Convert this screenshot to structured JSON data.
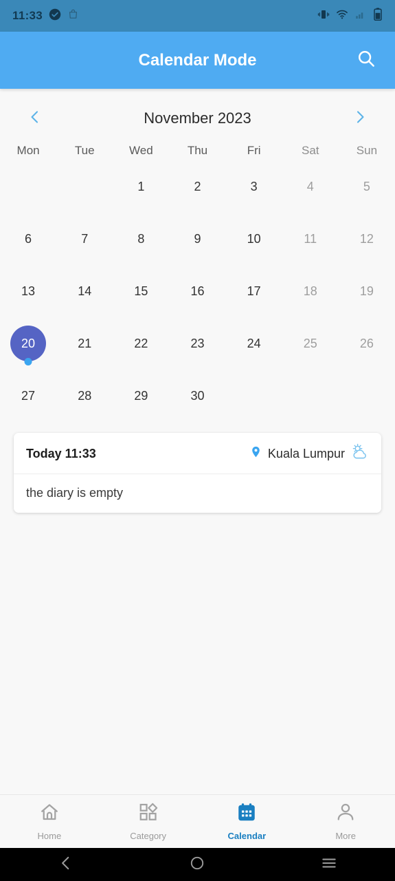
{
  "status_bar": {
    "time": "11:33",
    "left_icons": [
      "check-circle-icon",
      "bag-icon"
    ],
    "right_icons": [
      "vibrate-icon",
      "wifi-icon",
      "signal-icon",
      "battery-icon"
    ]
  },
  "app_bar": {
    "title": "Calendar Mode",
    "search_icon": "search-icon",
    "background": "#4fabf2"
  },
  "calendar": {
    "month_title": "November 2023",
    "prev_icon": "chevron-left-icon",
    "next_icon": "chevron-right-icon",
    "weekdays": [
      {
        "label": "Mon",
        "weekend": false
      },
      {
        "label": "Tue",
        "weekend": false
      },
      {
        "label": "Wed",
        "weekend": false
      },
      {
        "label": "Thu",
        "weekend": false
      },
      {
        "label": "Fri",
        "weekend": false
      },
      {
        "label": "Sat",
        "weekend": true
      },
      {
        "label": "Sun",
        "weekend": true
      }
    ],
    "selected_day": 20,
    "selected_color": "#5564c4",
    "event_dot_color": "#3aa5f0",
    "weeks": [
      [
        {
          "day": "",
          "weekend": false,
          "empty": true
        },
        {
          "day": "",
          "weekend": false,
          "empty": true
        },
        {
          "day": "1",
          "weekend": false,
          "empty": false
        },
        {
          "day": "2",
          "weekend": false,
          "empty": false
        },
        {
          "day": "3",
          "weekend": false,
          "empty": false
        },
        {
          "day": "4",
          "weekend": true,
          "empty": false
        },
        {
          "day": "5",
          "weekend": true,
          "empty": false
        }
      ],
      [
        {
          "day": "6",
          "weekend": false,
          "empty": false
        },
        {
          "day": "7",
          "weekend": false,
          "empty": false
        },
        {
          "day": "8",
          "weekend": false,
          "empty": false
        },
        {
          "day": "9",
          "weekend": false,
          "empty": false
        },
        {
          "day": "10",
          "weekend": false,
          "empty": false
        },
        {
          "day": "11",
          "weekend": true,
          "empty": false
        },
        {
          "day": "12",
          "weekend": true,
          "empty": false
        }
      ],
      [
        {
          "day": "13",
          "weekend": false,
          "empty": false
        },
        {
          "day": "14",
          "weekend": false,
          "empty": false
        },
        {
          "day": "15",
          "weekend": false,
          "empty": false
        },
        {
          "day": "16",
          "weekend": false,
          "empty": false
        },
        {
          "day": "17",
          "weekend": false,
          "empty": false
        },
        {
          "day": "18",
          "weekend": true,
          "empty": false
        },
        {
          "day": "19",
          "weekend": true,
          "empty": false
        }
      ],
      [
        {
          "day": "20",
          "weekend": false,
          "empty": false,
          "selected": true,
          "has_event": true
        },
        {
          "day": "21",
          "weekend": false,
          "empty": false
        },
        {
          "day": "22",
          "weekend": false,
          "empty": false
        },
        {
          "day": "23",
          "weekend": false,
          "empty": false
        },
        {
          "day": "24",
          "weekend": false,
          "empty": false
        },
        {
          "day": "25",
          "weekend": true,
          "empty": false
        },
        {
          "day": "26",
          "weekend": true,
          "empty": false
        }
      ],
      [
        {
          "day": "27",
          "weekend": false,
          "empty": false
        },
        {
          "day": "28",
          "weekend": false,
          "empty": false
        },
        {
          "day": "29",
          "weekend": false,
          "empty": false
        },
        {
          "day": "30",
          "weekend": false,
          "empty": false
        },
        {
          "day": "",
          "weekend": false,
          "empty": true
        },
        {
          "day": "",
          "weekend": true,
          "empty": true
        },
        {
          "day": "",
          "weekend": true,
          "empty": true
        }
      ]
    ]
  },
  "diary_card": {
    "today_label": "Today 11:33",
    "location_icon": "location-pin-icon",
    "location": "Kuala Lumpur",
    "weather_icon": "partly-cloudy-icon",
    "empty_text": "the diary is empty"
  },
  "tabs": [
    {
      "label": "Home",
      "icon": "home-icon",
      "active": false
    },
    {
      "label": "Category",
      "icon": "category-icon",
      "active": false
    },
    {
      "label": "Calendar",
      "icon": "calendar-icon",
      "active": true
    },
    {
      "label": "More",
      "icon": "person-icon",
      "active": false
    }
  ],
  "android_nav": {
    "back_icon": "back-chevron-icon",
    "home_icon": "home-circle-icon",
    "recents_icon": "recents-menu-icon"
  }
}
